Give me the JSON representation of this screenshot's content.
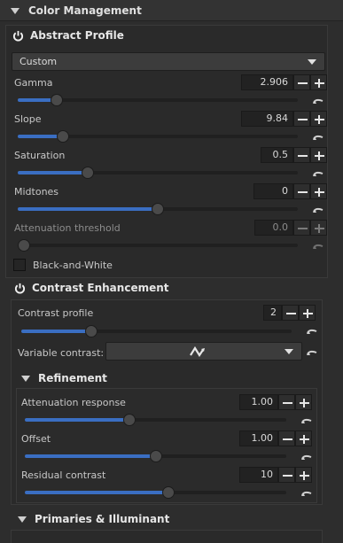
{
  "header": {
    "title": "Color Management"
  },
  "abstract": {
    "title": "Abstract Profile",
    "profile_value": "Custom",
    "sliders": [
      {
        "label": "Gamma",
        "value": "2.906",
        "fill": 0.14
      },
      {
        "label": "Slope",
        "value": "9.84",
        "fill": 0.16
      },
      {
        "label": "Saturation",
        "value": "0.5",
        "fill": 0.25
      },
      {
        "label": "Midtones",
        "value": "0",
        "fill": 0.5
      },
      {
        "label": "Attenuation threshold",
        "value": "0.0",
        "fill": 0.0
      }
    ],
    "bw_label": "Black-and-White"
  },
  "contrast": {
    "title": "Contrast Enhancement",
    "profile_label": "Contrast profile",
    "profile_value": "2",
    "profile_fill": 0.25,
    "variable_label": "Variable contrast:",
    "refinement": {
      "title": "Refinement",
      "sliders": [
        {
          "label": "Attenuation response",
          "value": "1.00",
          "fill": 0.4
        },
        {
          "label": "Offset",
          "value": "1.00",
          "fill": 0.5
        },
        {
          "label": "Residual contrast",
          "value": "10",
          "fill": 0.55
        }
      ]
    }
  },
  "primaries": {
    "title": "Primaries & Illuminant"
  }
}
